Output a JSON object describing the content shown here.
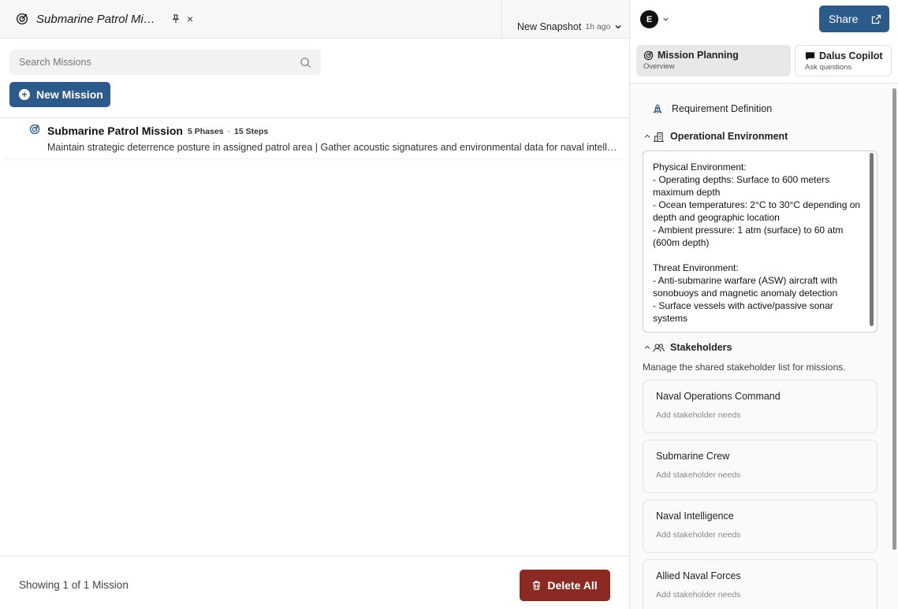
{
  "tab": {
    "title": "Submarine Patrol Mission",
    "pin_icon": "pin-icon",
    "close_label": "×"
  },
  "snapshot": {
    "label": "New Snapshot",
    "time": "1h ago"
  },
  "search": {
    "placeholder": "Search Missions"
  },
  "new_mission": {
    "label": "New Mission"
  },
  "missions": [
    {
      "title": "Submarine Patrol Mission",
      "phases": "5 Phases",
      "steps": "15 Steps",
      "description": "Maintain strategic deterrence posture in assigned patrol area | Gather acoustic signatures and environmental data for naval intelligence"
    }
  ],
  "footer": {
    "count": "Showing 1 of 1 Mission",
    "delete_label": "Delete All"
  },
  "user": {
    "initial": "E"
  },
  "share": {
    "label": "Share"
  },
  "modes": [
    {
      "title": "Mission Planning",
      "subtitle": "Overview"
    },
    {
      "title": "Dalus Copilot",
      "subtitle": "Ask questions"
    }
  ],
  "requirement": {
    "label": "Requirement Definition"
  },
  "operational": {
    "label": "Operational Environment",
    "text": "Physical Environment:\n- Operating depths: Surface to 600 meters maximum depth\n- Ocean temperatures: 2°C to 30°C depending on depth and geographic location\n- Ambient pressure: 1 atm (surface) to 60 atm (600m depth)\n\nThreat Environment:\n- Anti-submarine warfare (ASW) aircraft with sonobuoys and magnetic anomaly detection\n- Surface vessels with active/passive sonar systems"
  },
  "stakeholders": {
    "label": "Stakeholders",
    "description": "Manage the shared stakeholder list for missions.",
    "items": [
      {
        "name": "Naval Operations Command",
        "needs_placeholder": "Add stakeholder needs"
      },
      {
        "name": "Submarine Crew",
        "needs_placeholder": "Add stakeholder needs"
      },
      {
        "name": "Naval Intelligence",
        "needs_placeholder": "Add stakeholder needs"
      },
      {
        "name": "Allied Naval Forces",
        "needs_placeholder": "Add stakeholder needs"
      }
    ]
  },
  "colors": {
    "primary": "#2c5a8a",
    "danger": "#8a2a22"
  }
}
